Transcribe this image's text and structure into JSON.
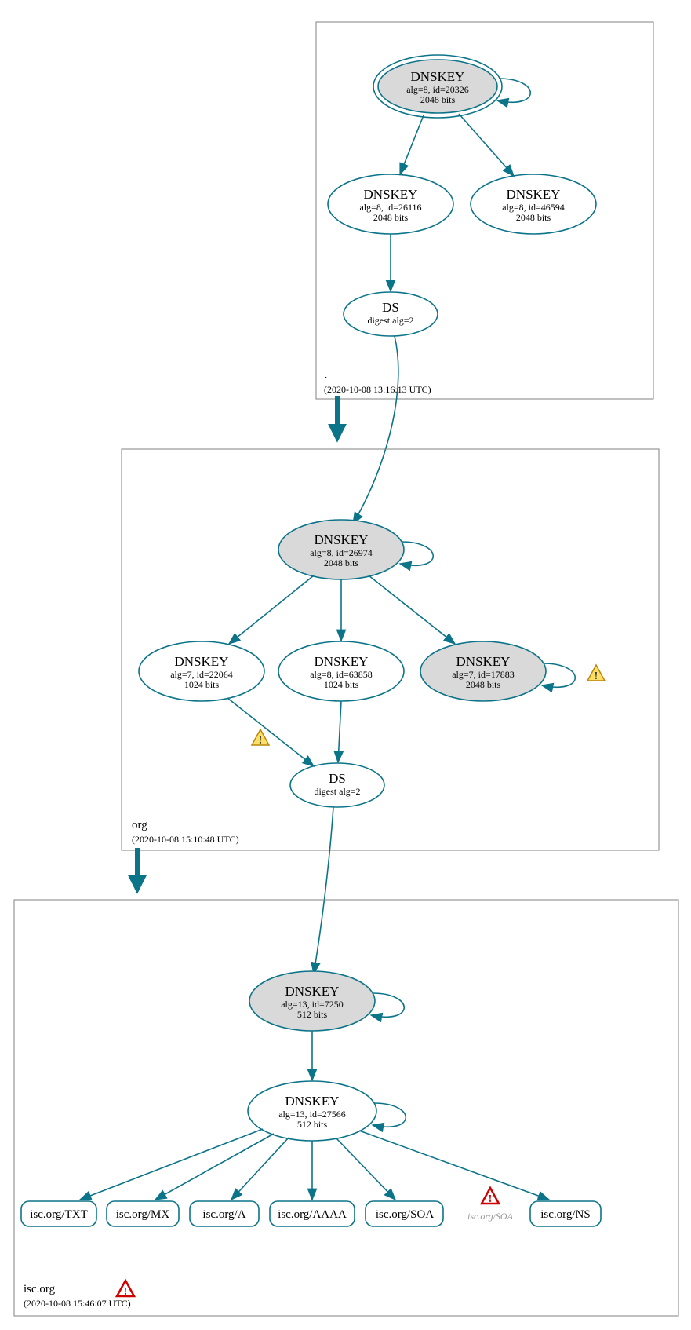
{
  "colors": {
    "stroke": "#0c7489",
    "grey_fill": "#d9d9d9"
  },
  "zones": {
    "root": {
      "name": ".",
      "timestamp": "(2020-10-08 13:16:13 UTC)",
      "nodes": {
        "ksk": {
          "title": "DNSKEY",
          "line1": "alg=8, id=20326",
          "line2": "2048 bits"
        },
        "zsk1": {
          "title": "DNSKEY",
          "line1": "alg=8, id=26116",
          "line2": "2048 bits"
        },
        "zsk2": {
          "title": "DNSKEY",
          "line1": "alg=8, id=46594",
          "line2": "2048 bits"
        },
        "ds": {
          "title": "DS",
          "line1": "digest alg=2"
        }
      }
    },
    "org": {
      "name": "org",
      "timestamp": "(2020-10-08 15:10:48 UTC)",
      "nodes": {
        "ksk": {
          "title": "DNSKEY",
          "line1": "alg=8, id=26974",
          "line2": "2048 bits"
        },
        "z1": {
          "title": "DNSKEY",
          "line1": "alg=7, id=22064",
          "line2": "1024 bits"
        },
        "z2": {
          "title": "DNSKEY",
          "line1": "alg=8, id=63858",
          "line2": "1024 bits"
        },
        "z3": {
          "title": "DNSKEY",
          "line1": "alg=7, id=17883",
          "line2": "2048 bits"
        },
        "ds": {
          "title": "DS",
          "line1": "digest alg=2"
        }
      }
    },
    "isc": {
      "name": "isc.org",
      "timestamp": "(2020-10-08 15:46:07 UTC)",
      "nodes": {
        "ksk": {
          "title": "DNSKEY",
          "line1": "alg=13, id=7250",
          "line2": "512 bits"
        },
        "zsk": {
          "title": "DNSKEY",
          "line1": "alg=13, id=27566",
          "line2": "512 bits"
        }
      },
      "records": {
        "txt": "isc.org/TXT",
        "mx": "isc.org/MX",
        "a": "isc.org/A",
        "aaaa": "isc.org/AAAA",
        "soa": "isc.org/SOA",
        "soa_faded": "isc.org/SOA",
        "ns": "isc.org/NS"
      }
    }
  }
}
